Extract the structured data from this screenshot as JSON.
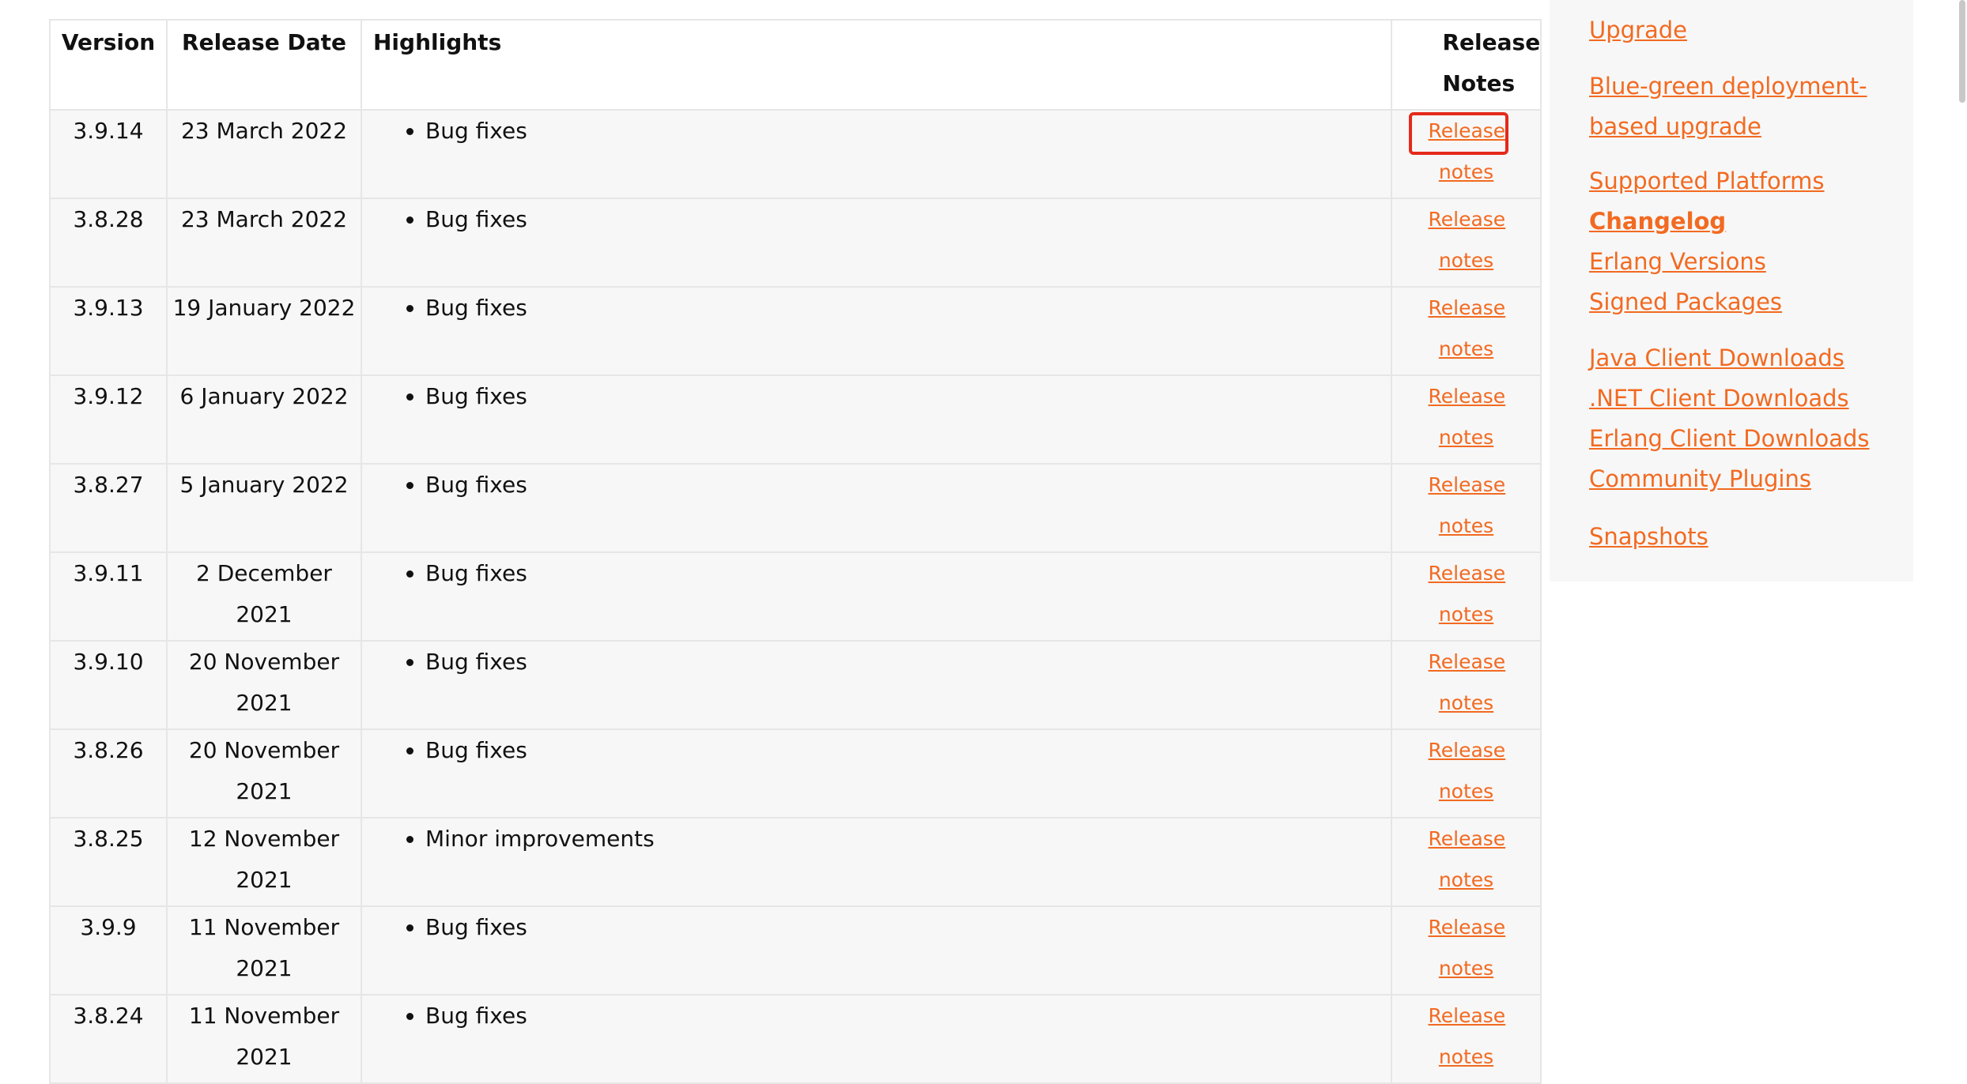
{
  "table": {
    "headers": {
      "version": "Version",
      "release_date": "Release Date",
      "highlights": "Highlights",
      "release_notes": "Release Notes"
    },
    "rows": [
      {
        "version": "3.9.14",
        "date": "23 March 2022",
        "highlight": "Bug fixes",
        "notes_link": "Release notes"
      },
      {
        "version": "3.8.28",
        "date": "23 March 2022",
        "highlight": "Bug fixes",
        "notes_link": "Release notes"
      },
      {
        "version": "3.9.13",
        "date": "19 January 2022",
        "highlight": "Bug fixes",
        "notes_link": "Release notes"
      },
      {
        "version": "3.9.12",
        "date": "6 January 2022",
        "highlight": "Bug fixes",
        "notes_link": "Release notes"
      },
      {
        "version": "3.8.27",
        "date": "5 January 2022",
        "highlight": "Bug fixes",
        "notes_link": "Release notes"
      },
      {
        "version": "3.9.11",
        "date": "2 December 2021",
        "highlight": "Bug fixes",
        "notes_link": "Release notes"
      },
      {
        "version": "3.9.10",
        "date": "20 November 2021",
        "highlight": "Bug fixes",
        "notes_link": "Release notes"
      },
      {
        "version": "3.8.26",
        "date": "20 November 2021",
        "highlight": "Bug fixes",
        "notes_link": "Release notes"
      },
      {
        "version": "3.8.25",
        "date": "12 November 2021",
        "highlight": "Minor improvements",
        "notes_link": "Release notes"
      },
      {
        "version": "3.9.9",
        "date": "11 November 2021",
        "highlight": "Bug fixes",
        "notes_link": "Release notes"
      },
      {
        "version": "3.8.24",
        "date": "11 November 2021",
        "highlight": "Bug fixes",
        "notes_link": "Release notes"
      }
    ]
  },
  "sidebar": {
    "groups": [
      {
        "items": [
          {
            "label": "Upgrade"
          },
          {
            "label": "Blue-green deployment-based upgrade"
          }
        ]
      },
      {
        "items": [
          {
            "label": "Supported Platforms"
          },
          {
            "label": "Changelog",
            "active": true
          },
          {
            "label": "Erlang Versions"
          },
          {
            "label": "Signed Packages"
          }
        ]
      },
      {
        "items": [
          {
            "label": "Java Client Downloads"
          },
          {
            "label": ".NET Client Downloads"
          },
          {
            "label": "Erlang Client Downloads"
          },
          {
            "label": "Community Plugins"
          }
        ]
      },
      {
        "items": [
          {
            "label": "Snapshots"
          }
        ]
      }
    ]
  },
  "colors": {
    "link": "#f26a21",
    "highlight_box": "#e42a1b",
    "row_background": "#f7f7f7",
    "border": "#e6e6e6"
  }
}
